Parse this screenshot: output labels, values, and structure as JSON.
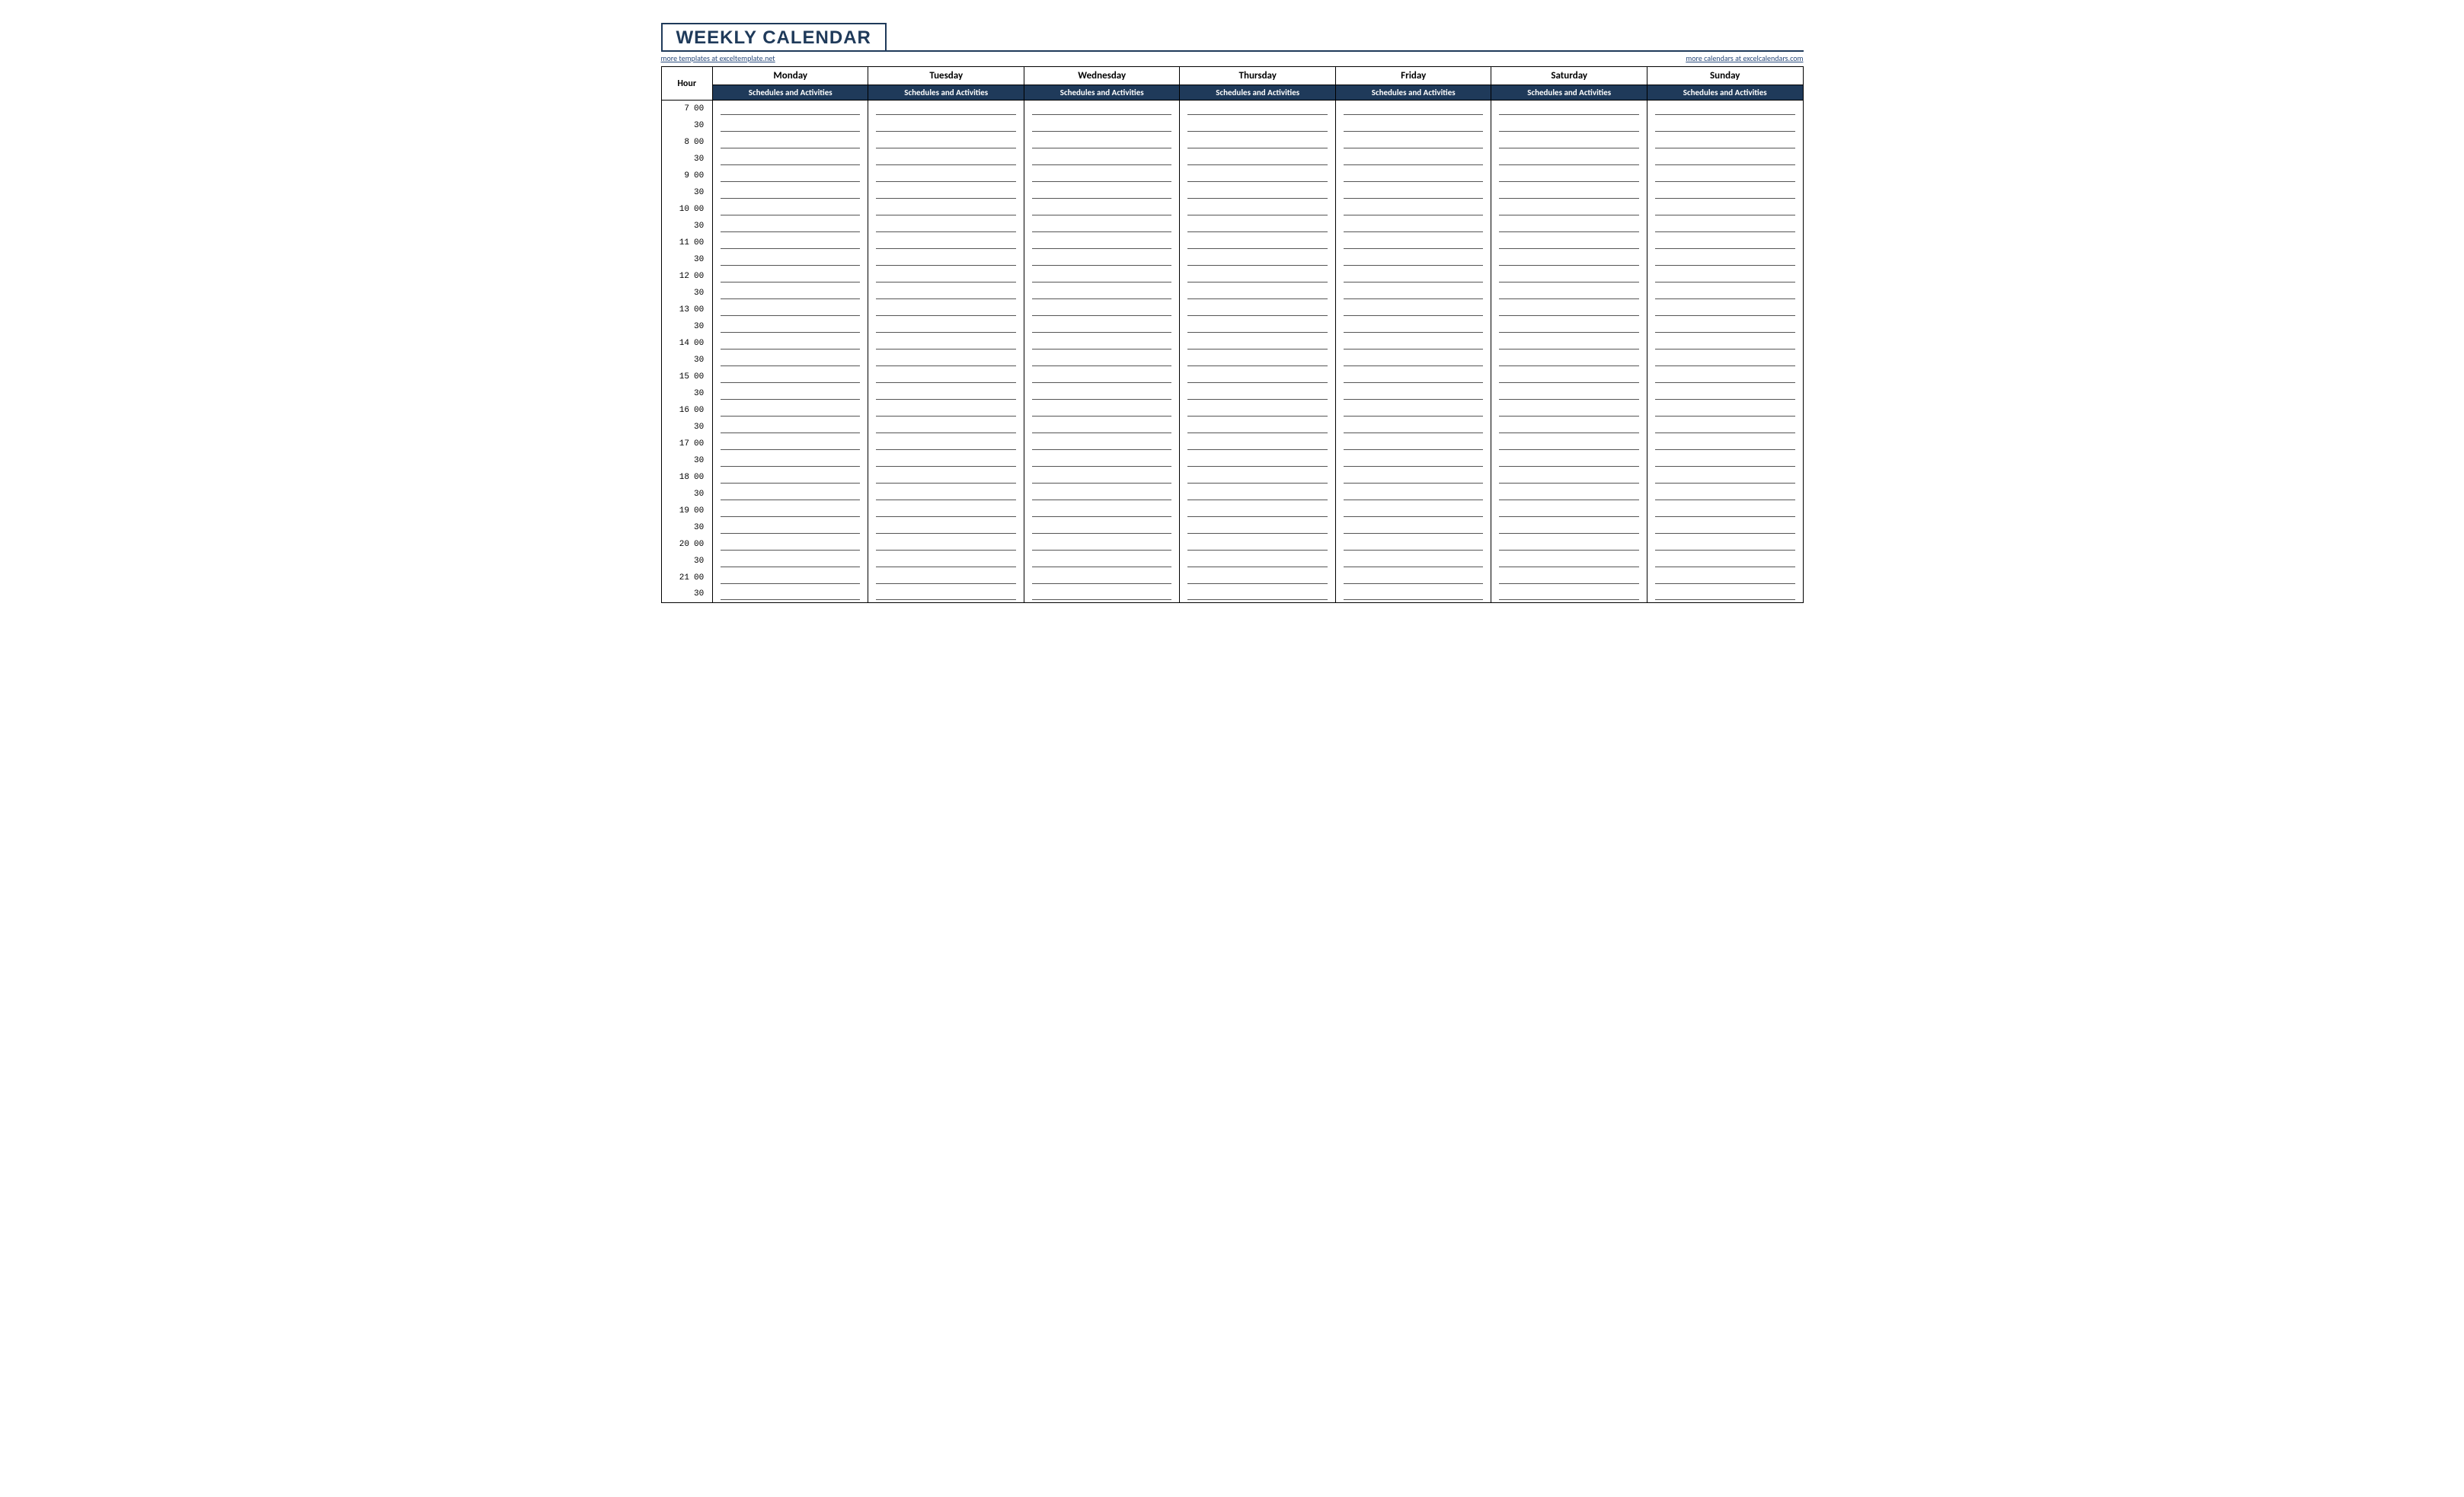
{
  "title": "WEEKLY CALENDAR",
  "links": {
    "left": "more templates at exceltemplate.net",
    "right": "more calendars at excelcalendars.com"
  },
  "headers": {
    "hour": "Hour",
    "sub": "Schedules and Activities"
  },
  "days": [
    "Monday",
    "Tuesday",
    "Wednesday",
    "Thursday",
    "Friday",
    "Saturday",
    "Sunday"
  ],
  "time_rows": [
    {
      "hour": "7",
      "minute": "00"
    },
    {
      "hour": "",
      "minute": "30"
    },
    {
      "hour": "8",
      "minute": "00"
    },
    {
      "hour": "",
      "minute": "30"
    },
    {
      "hour": "9",
      "minute": "00"
    },
    {
      "hour": "",
      "minute": "30"
    },
    {
      "hour": "10",
      "minute": "00"
    },
    {
      "hour": "",
      "minute": "30"
    },
    {
      "hour": "11",
      "minute": "00"
    },
    {
      "hour": "",
      "minute": "30"
    },
    {
      "hour": "12",
      "minute": "00"
    },
    {
      "hour": "",
      "minute": "30"
    },
    {
      "hour": "13",
      "minute": "00"
    },
    {
      "hour": "",
      "minute": "30"
    },
    {
      "hour": "14",
      "minute": "00"
    },
    {
      "hour": "",
      "minute": "30"
    },
    {
      "hour": "15",
      "minute": "00"
    },
    {
      "hour": "",
      "minute": "30"
    },
    {
      "hour": "16",
      "minute": "00"
    },
    {
      "hour": "",
      "minute": "30"
    },
    {
      "hour": "17",
      "minute": "00"
    },
    {
      "hour": "",
      "minute": "30"
    },
    {
      "hour": "18",
      "minute": "00"
    },
    {
      "hour": "",
      "minute": "30"
    },
    {
      "hour": "19",
      "minute": "00"
    },
    {
      "hour": "",
      "minute": "30"
    },
    {
      "hour": "20",
      "minute": "00"
    },
    {
      "hour": "",
      "minute": "30"
    },
    {
      "hour": "21",
      "minute": "00"
    },
    {
      "hour": "",
      "minute": "30"
    }
  ]
}
